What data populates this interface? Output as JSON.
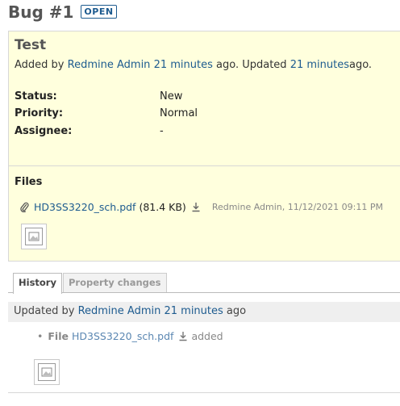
{
  "header": {
    "title": "Bug #1",
    "status_badge": "OPEN"
  },
  "issue": {
    "subject": "Test",
    "author_prefix": "Added by",
    "author": "Redmine Admin",
    "created": "21 minutes",
    "ago_updated": "ago. Updated",
    "updated": "21 minutes",
    "ago_end": "ago.",
    "attributes": [
      {
        "label": "Status:",
        "value": "New"
      },
      {
        "label": "Priority:",
        "value": "Normal"
      },
      {
        "label": "Assignee:",
        "value": "-"
      }
    ]
  },
  "files": {
    "heading": "Files",
    "items": [
      {
        "name": "HD3SS3220_sch.pdf",
        "size": "(81.4 KB)",
        "meta": "Redmine Admin, 11/12/2021 09:11 PM"
      }
    ]
  },
  "tabs": [
    {
      "label": "History"
    },
    {
      "label": "Property changes"
    }
  ],
  "journal": {
    "prefix": "Updated by",
    "author": "Redmine Admin",
    "time": "21 minutes",
    "suffix": "ago",
    "detail": {
      "bullet": "•",
      "field": "File",
      "filename": "HD3SS3220_sch.pdf",
      "action": "added"
    }
  },
  "icons": [
    "paperclip-icon",
    "download-icon",
    "thumbnail-icon"
  ],
  "colors": {
    "link": "#1d5b8f",
    "issue_bg": "#ffffdd",
    "journal_bg": "#efefef"
  }
}
